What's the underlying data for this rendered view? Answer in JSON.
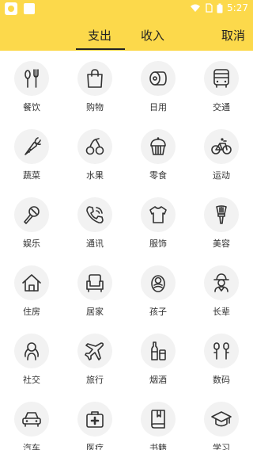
{
  "status_bar": {
    "time": "5:27"
  },
  "tabs": [
    {
      "label": "支出",
      "active": true
    },
    {
      "label": "收入",
      "active": false
    }
  ],
  "cancel_label": "取消",
  "colors": {
    "header_bg": "#fcd94b",
    "icon_bg": "#f2f2f2"
  },
  "categories": [
    {
      "label": "餐饮",
      "icon": "utensils-icon"
    },
    {
      "label": "购物",
      "icon": "shopping-bag-icon"
    },
    {
      "label": "日用",
      "icon": "toilet-paper-icon"
    },
    {
      "label": "交通",
      "icon": "bus-icon"
    },
    {
      "label": "蔬菜",
      "icon": "carrot-icon"
    },
    {
      "label": "水果",
      "icon": "cherry-icon"
    },
    {
      "label": "零食",
      "icon": "cupcake-icon"
    },
    {
      "label": "运动",
      "icon": "bicycle-icon"
    },
    {
      "label": "娱乐",
      "icon": "microphone-icon"
    },
    {
      "label": "通讯",
      "icon": "phone-icon"
    },
    {
      "label": "服饰",
      "icon": "tshirt-icon"
    },
    {
      "label": "美容",
      "icon": "makeup-brush-icon"
    },
    {
      "label": "住房",
      "icon": "house-icon"
    },
    {
      "label": "居家",
      "icon": "armchair-icon"
    },
    {
      "label": "孩子",
      "icon": "baby-icon"
    },
    {
      "label": "长辈",
      "icon": "elder-icon"
    },
    {
      "label": "社交",
      "icon": "people-icon"
    },
    {
      "label": "旅行",
      "icon": "airplane-icon"
    },
    {
      "label": "烟酒",
      "icon": "bottles-icon"
    },
    {
      "label": "数码",
      "icon": "earphones-icon"
    },
    {
      "label": "汽车",
      "icon": "car-icon"
    },
    {
      "label": "医疗",
      "icon": "first-aid-icon"
    },
    {
      "label": "书籍",
      "icon": "book-icon"
    },
    {
      "label": "学习",
      "icon": "graduation-cap-icon"
    }
  ]
}
